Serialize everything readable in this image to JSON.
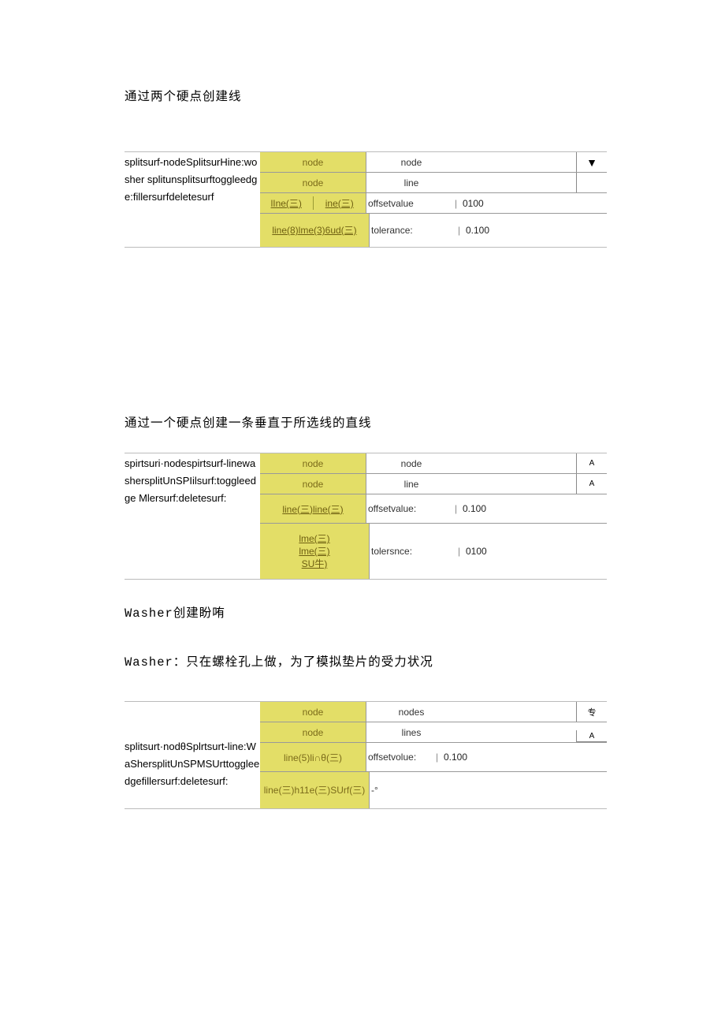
{
  "h1": "通过两个硬点创建线",
  "t1": {
    "left": "splitsurf-nodeSplitsurHine:wosher splitunsplitsurftoggleedge:fillersurfdeletesurf",
    "r1y": "node",
    "r1v": "node",
    "r1tri": "▼",
    "r2y": "node",
    "r2v": "line",
    "r3ya": "lIne(三)",
    "r3yb": "ine(三)",
    "r3l": "offsetvalue",
    "r3v": "0100",
    "r4y": "line(8)lme(3)6ud(三)",
    "r4l": "tolerance:",
    "r4v": "0.100"
  },
  "h2": "通过一个硬点创建一条垂直于所选线的直线",
  "t2": {
    "left": "spirtsuri·nodespirtsurf-linewashersplitUnSPIilsurf:toggleedge Mlersurf:deletesurf:",
    "r1y": "node",
    "r1v": "node",
    "r1tri": "A",
    "r2y": "node",
    "r2v": "line",
    "r2tri": "A",
    "r3y": "line(三)line(三)",
    "r3l": "offsetvalue:",
    "r3v": "0.100",
    "r4ya": "lme(三)",
    "r4yb": "lme(三)",
    "r4yc": "SU牛)",
    "r4l": "tolersnce:",
    "r4v": "0100"
  },
  "h3": "Washer创建盼哊",
  "h4": "Washer：只在螺栓孔上做，为了模拟垫片的受力状况",
  "t3": {
    "left": "splitsurt·nodθSplrtsurt-line:WaShersplitUnSPMSUrttoggleedgefillersurf:deletesurf:",
    "r1y": "node",
    "r1v": "nodes",
    "r1tri": "专",
    "r2y": "node",
    "r2v": "lines",
    "r2tri": "A",
    "r3y": "line(5)li∩θ(三)",
    "r3l": "offsetvolue:",
    "r3v": "0.100",
    "r4y": "line(三)h11e(三)SUrf(三)",
    "r4l": "-°"
  }
}
